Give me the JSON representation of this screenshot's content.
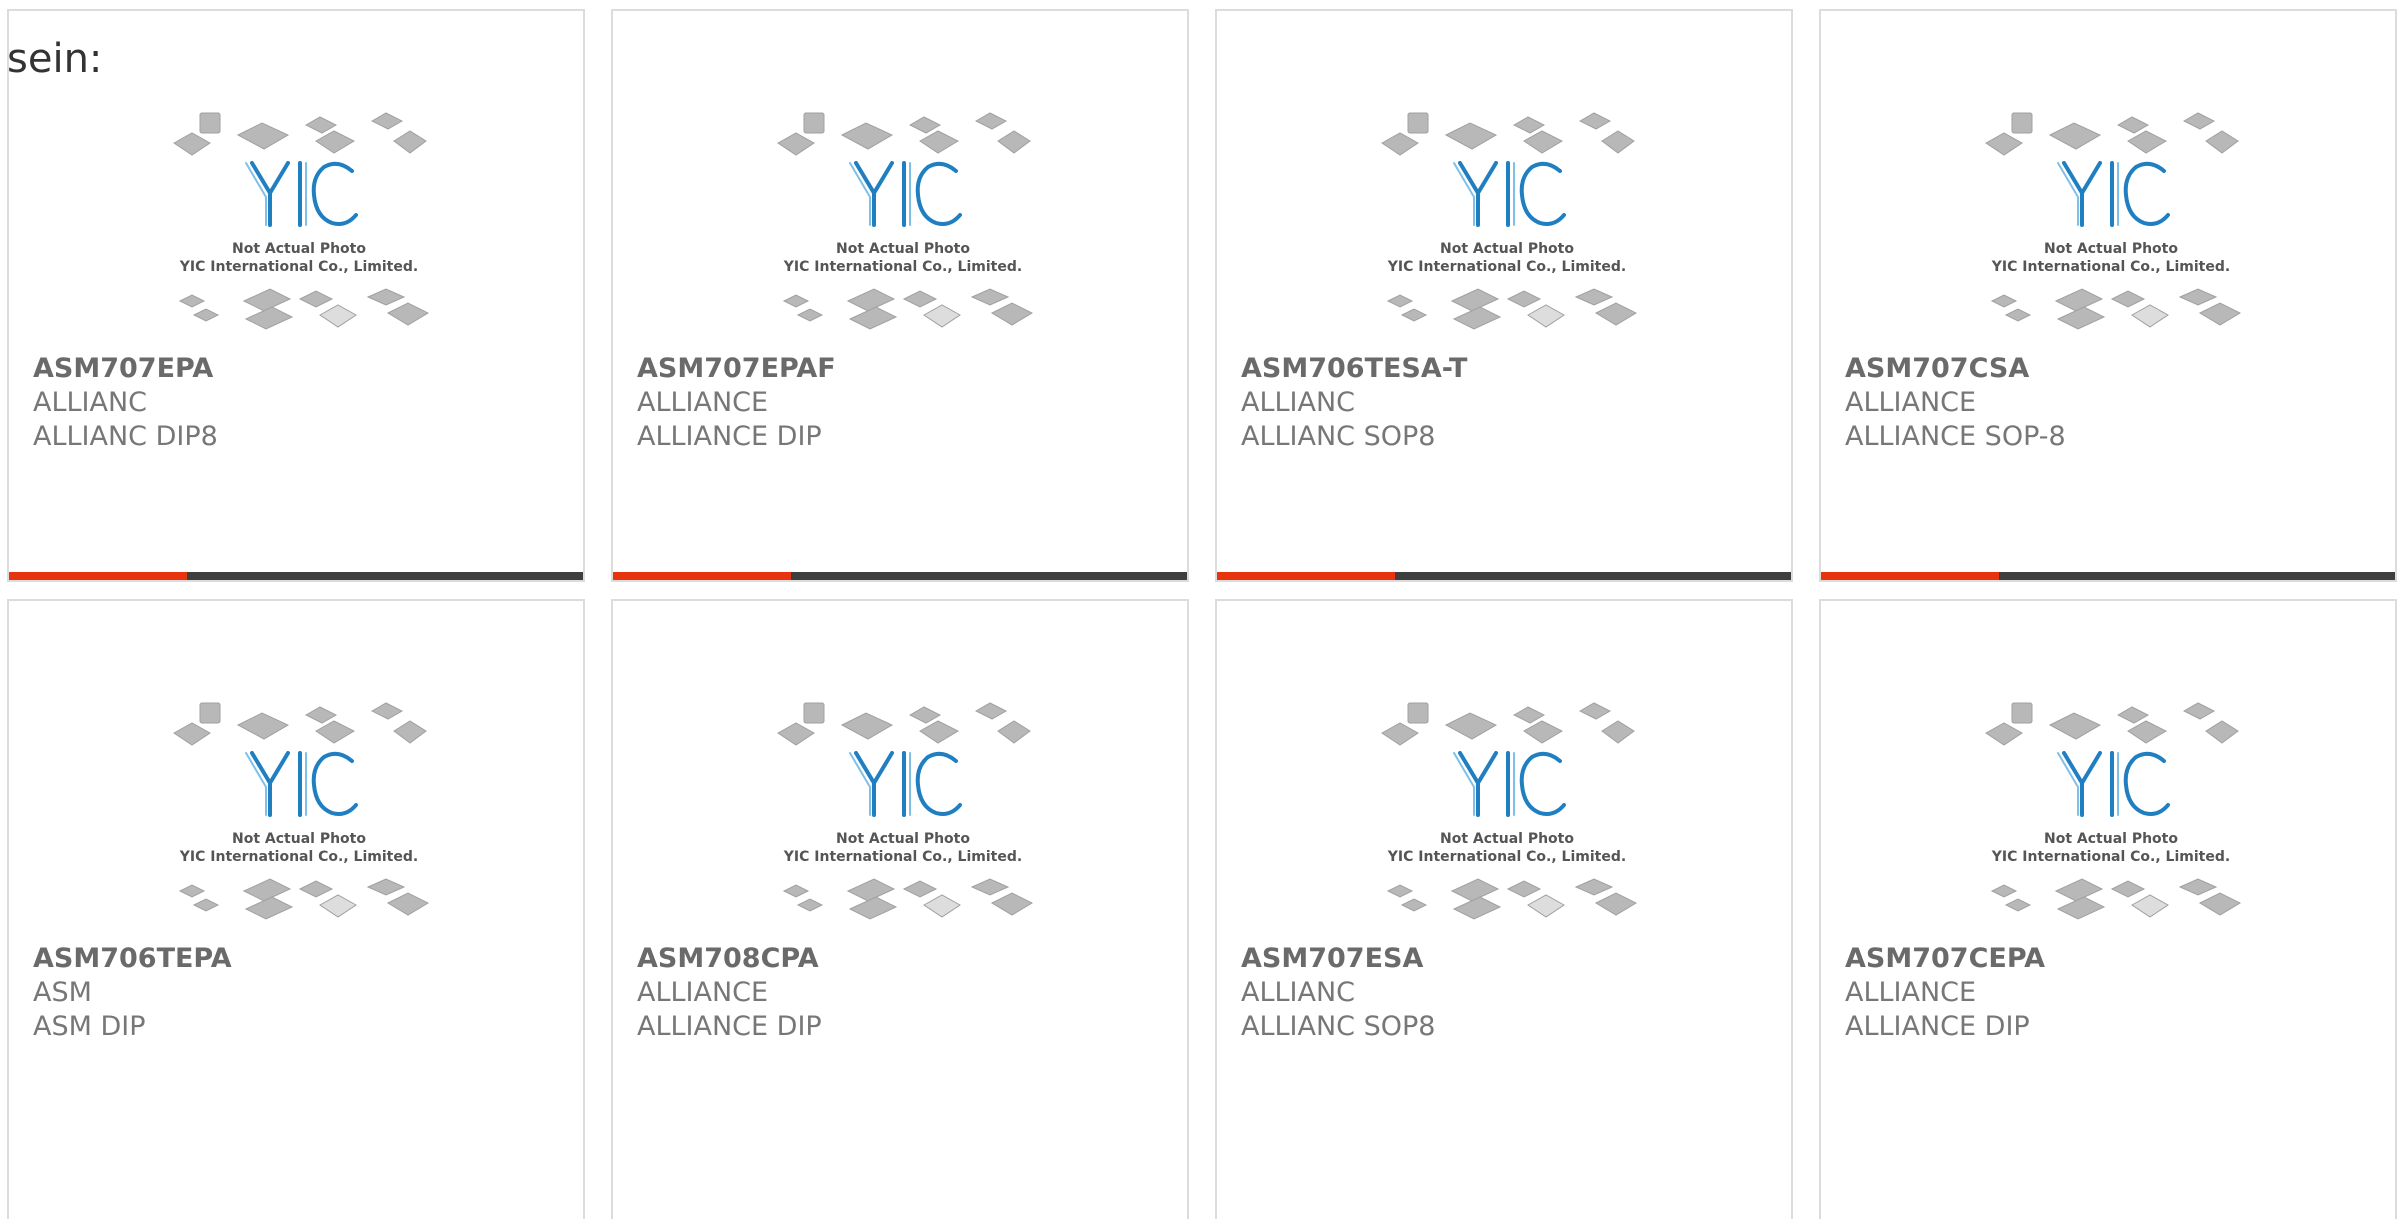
{
  "lead_text": "sein:",
  "accent_color": "#e8330f",
  "bar_color": "#3e3e3e",
  "placeholder": {
    "line1": "Not Actual Photo",
    "line2": "YIC International Co., Limited.",
    "logo_text": "YIC"
  },
  "products": [
    {
      "part": "ASM707EPA",
      "brand": "ALLIANC",
      "package": "ALLIANC DIP8",
      "progress": 0.31
    },
    {
      "part": "ASM707EPAF",
      "brand": "ALLIANCE",
      "package": "ALLIANCE DIP",
      "progress": 0.31
    },
    {
      "part": "ASM706TESA-T",
      "brand": "ALLIANC",
      "package": "ALLIANC SOP8",
      "progress": 0.31
    },
    {
      "part": "ASM707CSA",
      "brand": "ALLIANCE",
      "package": "ALLIANCE SOP-8",
      "progress": 0.31
    },
    {
      "part": "ASM706TEPA",
      "brand": "ASM",
      "package": "ASM DIP",
      "progress": 0
    },
    {
      "part": "ASM708CPA",
      "brand": "ALLIANCE",
      "package": "ALLIANCE DIP",
      "progress": 0
    },
    {
      "part": "ASM707ESA",
      "brand": "ALLIANC",
      "package": "ALLIANC SOP8",
      "progress": 0
    },
    {
      "part": "ASM707CEPA",
      "brand": "ALLIANCE",
      "package": "ALLIANCE DIP",
      "progress": 0
    }
  ]
}
